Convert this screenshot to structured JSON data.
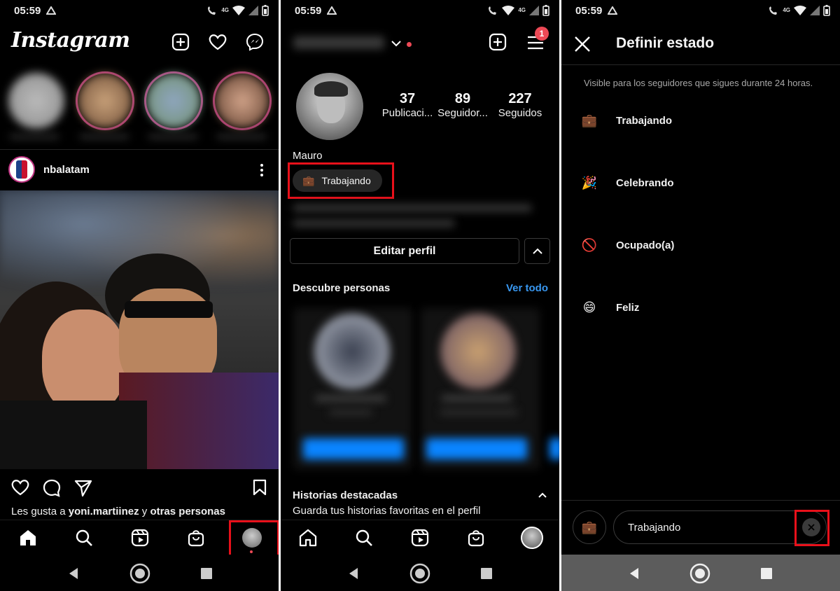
{
  "status_bar": {
    "time": "05:59",
    "network": "4G"
  },
  "feed": {
    "app_title": "Instagram",
    "post": {
      "username": "nbalatam",
      "likes_prefix": "Les gusta a ",
      "likes_user": "yoni.martiinez",
      "likes_mid": " y ",
      "likes_others": "otras personas"
    }
  },
  "profile": {
    "notification_count": "1",
    "stats": [
      {
        "value": "37",
        "label": "Publicaci..."
      },
      {
        "value": "89",
        "label": "Seguidor..."
      },
      {
        "value": "227",
        "label": "Seguidos"
      }
    ],
    "name": "Mauro",
    "status_chip": "Trabajando",
    "edit_button": "Editar perfil",
    "discover_title": "Descubre personas",
    "see_all": "Ver todo",
    "highlights_title": "Historias destacadas",
    "highlights_subtitle": "Guarda tus historias favoritas en el perfil"
  },
  "set_status": {
    "title": "Definir estado",
    "subtitle": "Visible para los seguidores que sigues durante 24 horas.",
    "options": [
      {
        "emoji": "💼",
        "label": "Trabajando"
      },
      {
        "emoji": "🎉",
        "label": "Celebrando"
      },
      {
        "emoji": "🚫",
        "label": "Ocupado(a)"
      },
      {
        "emoji": "😄",
        "label": "Feliz"
      }
    ],
    "input_value": "Trabajando",
    "input_emoji": "💼"
  },
  "colors": {
    "accent_blue": "#3897f0",
    "highlight_red": "#e8101a",
    "background": "#000000"
  }
}
